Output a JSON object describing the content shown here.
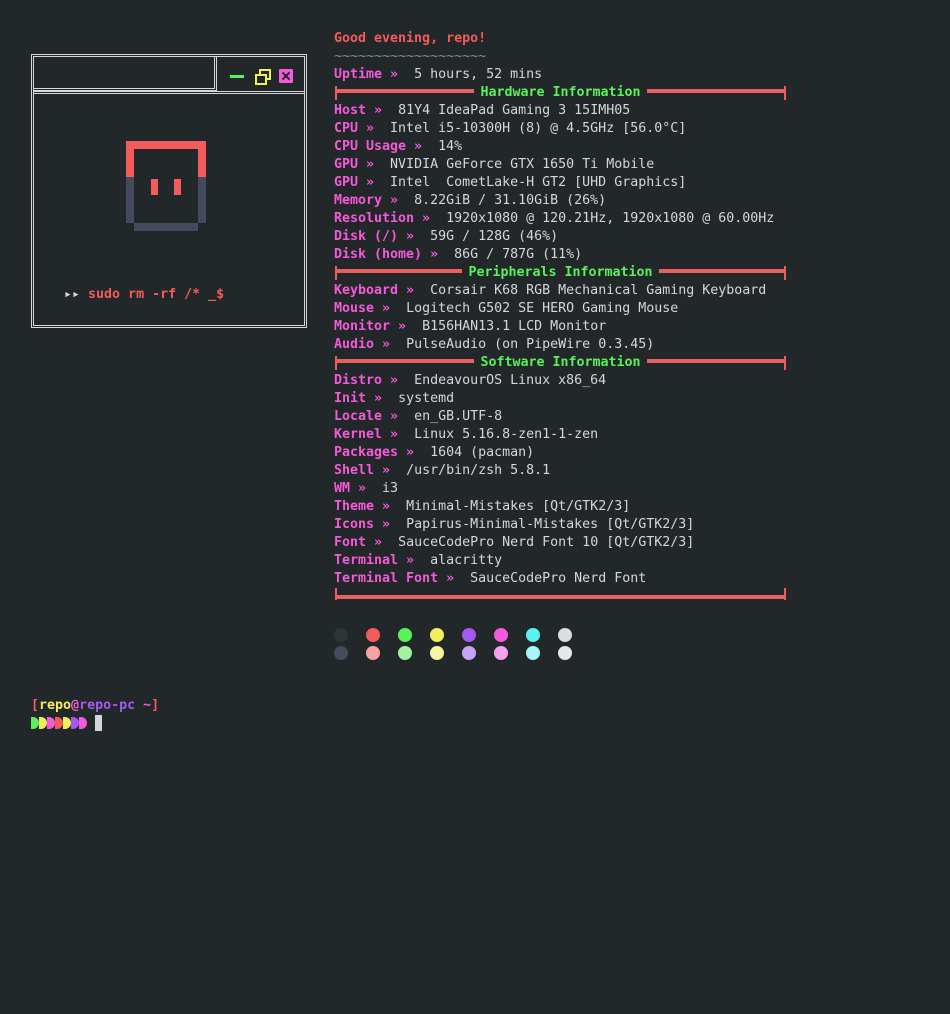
{
  "art": {
    "command_prefix": "▸▸",
    "command": "sudo rm -rf /* _$"
  },
  "greeting": "Good evening, repo!",
  "divider": "~~~~~~~~~~~~~~~~~~~",
  "uptime": {
    "key": "Uptime »",
    "value": "5 hours, 52 mins"
  },
  "hardware": {
    "title": "Hardware Information",
    "items": [
      {
        "key": "Host »",
        "value": "81Y4 IdeaPad Gaming 3 15IMH05"
      },
      {
        "key": "CPU »",
        "value": "Intel i5-10300H (8) @ 4.5GHz [56.0°C]"
      },
      {
        "key": "CPU Usage »",
        "value": "14%"
      },
      {
        "key": "GPU »",
        "value": "NVIDIA GeForce GTX 1650 Ti Mobile"
      },
      {
        "key": "GPU »",
        "value": "Intel  CometLake-H GT2 [UHD Graphics]"
      },
      {
        "key": "Memory »",
        "value": "8.22GiB / 31.10GiB (26%)"
      },
      {
        "key": "Resolution »",
        "value": "1920x1080 @ 120.21Hz, 1920x1080 @ 60.00Hz"
      },
      {
        "key": "Disk (/) »",
        "value": "59G / 128G (46%)"
      },
      {
        "key": "Disk (home) »",
        "value": "86G / 787G (11%)"
      }
    ]
  },
  "peripherals": {
    "title": "Peripherals Information",
    "items": [
      {
        "key": "Keyboard »",
        "value": "Corsair K68 RGB Mechanical Gaming Keyboard"
      },
      {
        "key": "Mouse »",
        "value": "Logitech G502 SE HERO Gaming Mouse"
      },
      {
        "key": "Monitor »",
        "value": "B156HAN13.1 LCD Monitor"
      },
      {
        "key": "Audio »",
        "value": "PulseAudio (on PipeWire 0.3.45)"
      }
    ]
  },
  "software": {
    "title": "Software Information",
    "items": [
      {
        "key": "Distro »",
        "value": "EndeavourOS Linux x86_64"
      },
      {
        "key": "Init »",
        "value": "systemd"
      },
      {
        "key": "Locale »",
        "value": "en_GB.UTF-8"
      },
      {
        "key": "Kernel »",
        "value": "Linux 5.16.8-zen1-1-zen"
      },
      {
        "key": "Packages »",
        "value": "1604 (pacman)"
      },
      {
        "key": "Shell »",
        "value": "/usr/bin/zsh 5.8.1"
      },
      {
        "key": "WM »",
        "value": "i3"
      },
      {
        "key": "Theme »",
        "value": "Minimal-Mistakes [Qt/GTK2/3]"
      },
      {
        "key": "Icons »",
        "value": "Papirus-Minimal-Mistakes [Qt/GTK2/3]"
      },
      {
        "key": "Font »",
        "value": "SauceCodePro Nerd Font 10 [Qt/GTK2/3]"
      },
      {
        "key": "Terminal »",
        "value": "alacritty"
      },
      {
        "key": "Terminal Font »",
        "value": "SauceCodePro Nerd Font"
      }
    ]
  },
  "palette": {
    "normal": [
      "#2f3438",
      "#f45b5b",
      "#5af25a",
      "#f2f05a",
      "#a35af2",
      "#f45ad9",
      "#5af2f2",
      "#dcdce2"
    ],
    "bright": [
      "#454b5e",
      "#f7a3a3",
      "#a3f2a3",
      "#f7f5a3",
      "#c8a3f7",
      "#f7a3ec",
      "#a3f7f7",
      "#e6e6ec"
    ]
  },
  "prompt": {
    "open": "[",
    "user": "repo",
    "at": "@",
    "host": "repo-pc",
    "dir": " ~",
    "close": "]",
    "chevron_colors": [
      "#5af25a",
      "#f2f05a",
      "#f45ad9",
      "#f45b5b",
      "#f2f05a",
      "#a35af2",
      "#f45ad9"
    ]
  }
}
